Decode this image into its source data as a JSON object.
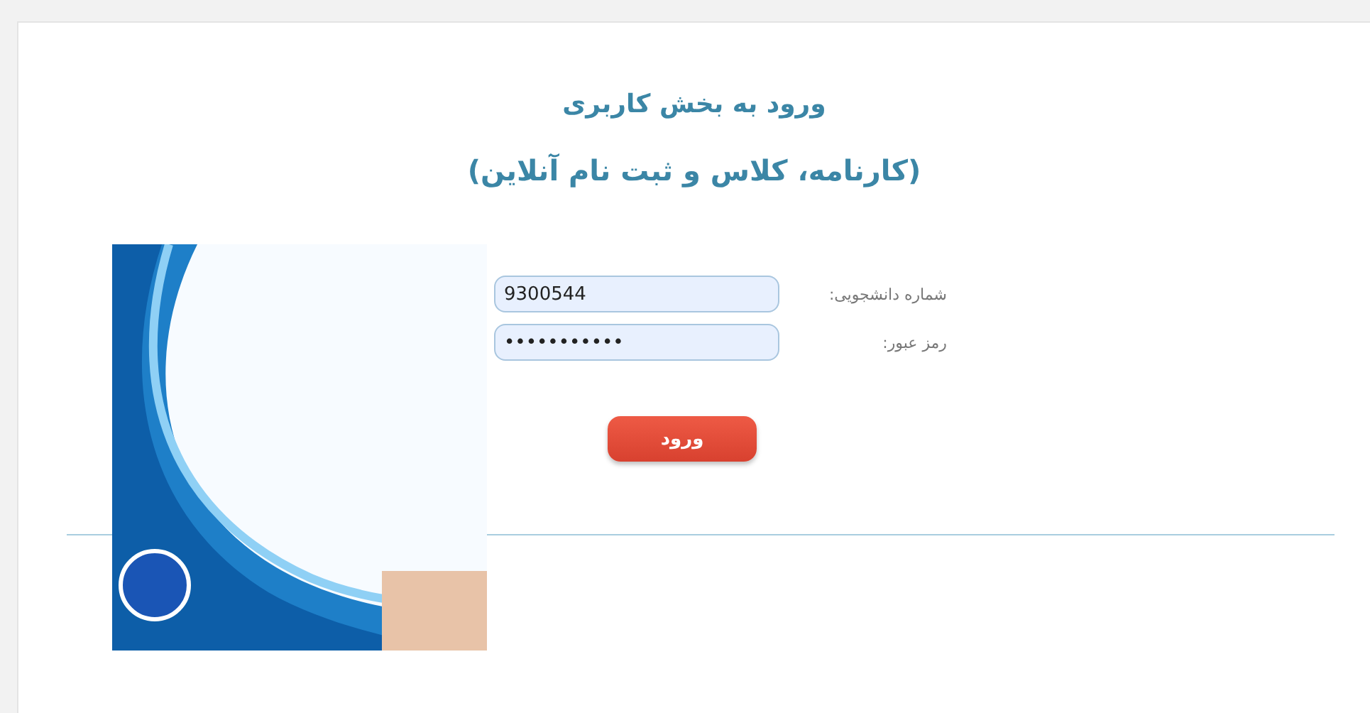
{
  "heading": {
    "title": "ورود به بخش کاربری",
    "subtitle": "(کارنامه، کلاس و ثبت نام آنلاین)"
  },
  "fields": [
    {
      "label": "شماره دانشجویی:",
      "value": "9300544"
    },
    {
      "label": "رمز عبور:",
      "value": "•••••••••••"
    }
  ],
  "submit": {
    "label": "ورود"
  }
}
